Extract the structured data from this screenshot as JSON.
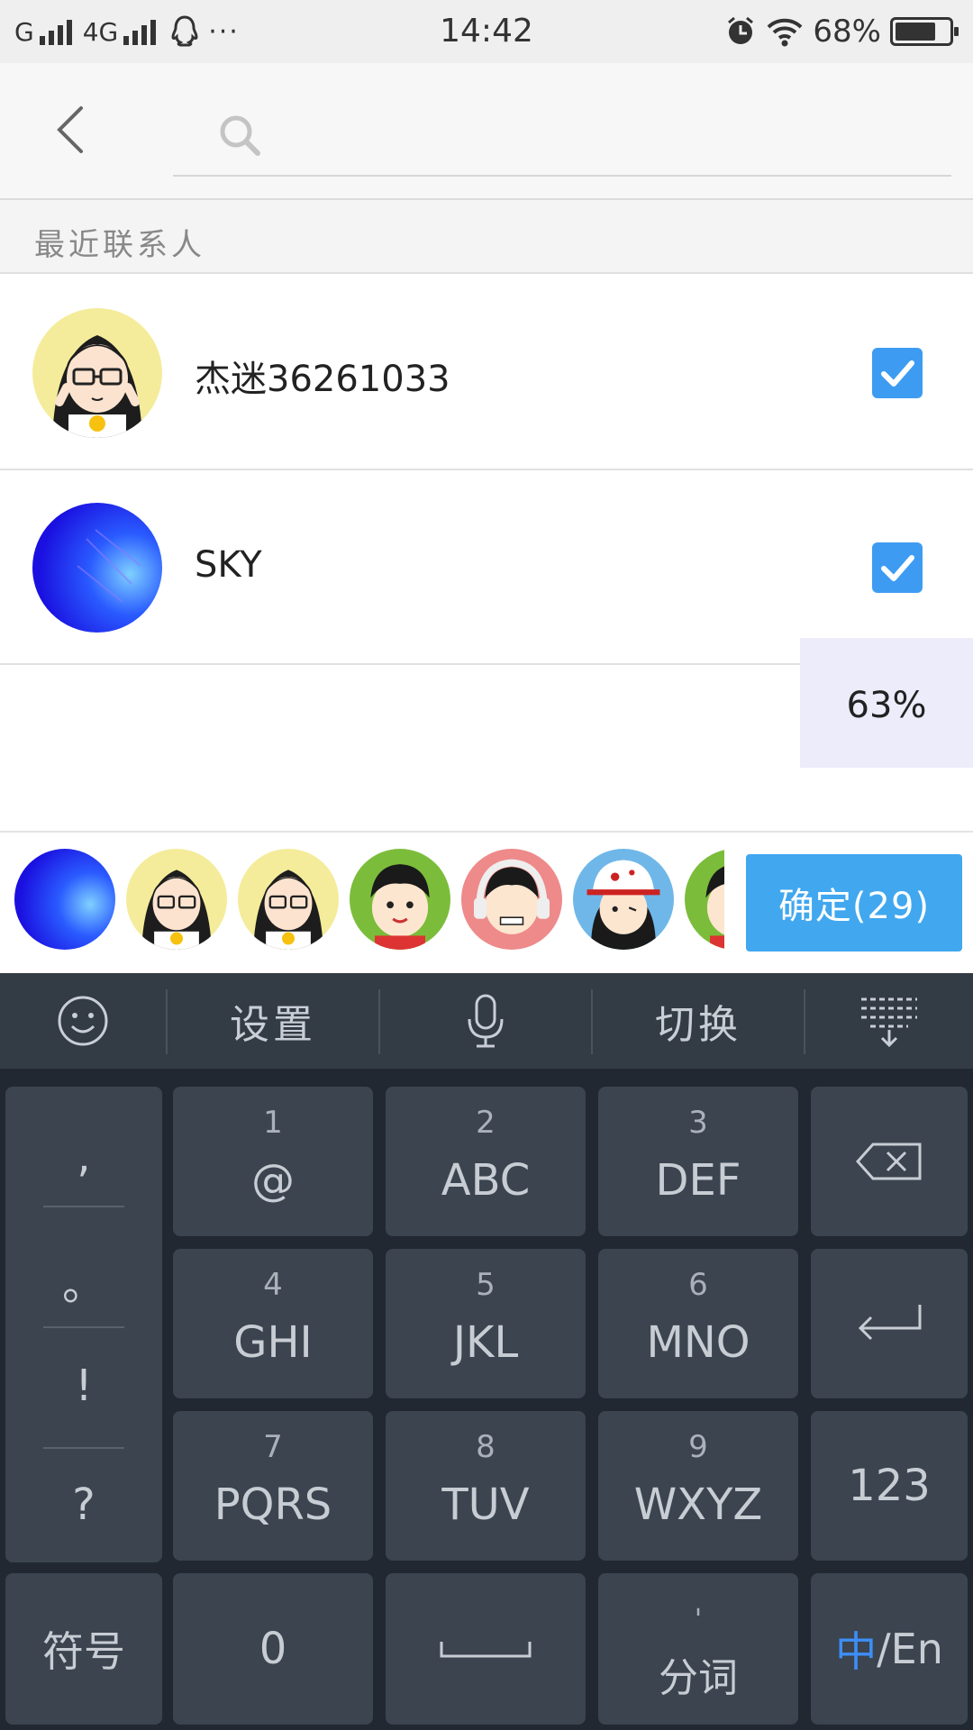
{
  "status_bar": {
    "carrier1": "G",
    "carrier2": "4G",
    "dots": "···",
    "time": "14:42",
    "battery": "68%"
  },
  "search": {
    "placeholder": ""
  },
  "section": {
    "title": "最近联系人"
  },
  "contacts": [
    {
      "name": "杰迷36261033",
      "checked": true
    },
    {
      "name": "SKY",
      "checked": true
    }
  ],
  "progress": {
    "text": "63%"
  },
  "selected": {
    "confirm_label": "确定(29)"
  },
  "keyboard": {
    "toolbar": {
      "settings": "设置",
      "switch": "切换"
    },
    "punct": [
      ",",
      "。",
      "!",
      "?"
    ],
    "keys": [
      {
        "num": "1",
        "letters": "@"
      },
      {
        "num": "2",
        "letters": "ABC"
      },
      {
        "num": "3",
        "letters": "DEF"
      },
      {
        "num": "4",
        "letters": "GHI"
      },
      {
        "num": "5",
        "letters": "JKL"
      },
      {
        "num": "6",
        "letters": "MNO"
      },
      {
        "num": "7",
        "letters": "PQRS"
      },
      {
        "num": "8",
        "letters": "TUV"
      },
      {
        "num": "9",
        "letters": "WXYZ"
      }
    ],
    "num_mode": "123",
    "symbols": "符号",
    "zero": "0",
    "fenci_mark": "'",
    "fenci": "分词",
    "lang_zh": "中",
    "lang_en": "/En"
  },
  "colors": {
    "accent": "#41a7ef",
    "checkbox": "#3d9cf2",
    "keyboard_bg": "#212832",
    "key_bg": "#3b444f"
  }
}
